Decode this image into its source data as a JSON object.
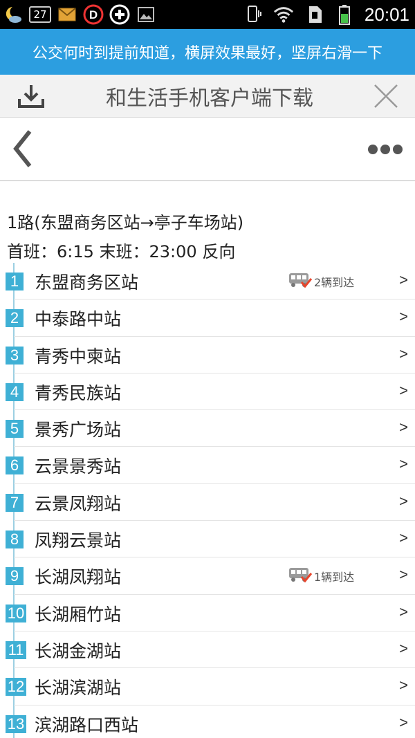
{
  "status_bar": {
    "notification_count": "27",
    "time": "20:01",
    "icons": [
      "weather-moon-icon",
      "calendar-badge-icon",
      "mail-icon",
      "d-app-icon",
      "add-circle-icon",
      "image-icon",
      "vibrate-icon",
      "wifi-icon",
      "sim-icon",
      "battery-icon"
    ]
  },
  "tip_banner": {
    "text": "公交何时到提前知道，横屏效果最好，坚屏右滑一下"
  },
  "download_bar": {
    "text": "和生活手机客户端下载"
  },
  "route": {
    "title": "1路(东盟商务区站→亭子车场站)",
    "times": "首班：6:15 末班：23:00 反向"
  },
  "stations": [
    {
      "num": "1",
      "name": "东盟商务区站",
      "bus": "2辆到达",
      "arrow": ">"
    },
    {
      "num": "2",
      "name": "中泰路中站",
      "bus": "",
      "arrow": ">"
    },
    {
      "num": "3",
      "name": "青秀中柬站",
      "bus": "",
      "arrow": ">"
    },
    {
      "num": "4",
      "name": "青秀民族站",
      "bus": "",
      "arrow": ">"
    },
    {
      "num": "5",
      "name": "景秀广场站",
      "bus": "",
      "arrow": ">"
    },
    {
      "num": "6",
      "name": "云景景秀站",
      "bus": "",
      "arrow": ">"
    },
    {
      "num": "7",
      "name": "云景凤翔站",
      "bus": "",
      "arrow": ">"
    },
    {
      "num": "8",
      "name": "凤翔云景站",
      "bus": "",
      "arrow": ">"
    },
    {
      "num": "9",
      "name": "长湖凤翔站",
      "bus": "1辆到达",
      "arrow": ">"
    },
    {
      "num": "10",
      "name": "长湖厢竹站",
      "bus": "",
      "arrow": ">"
    },
    {
      "num": "11",
      "name": "长湖金湖站",
      "bus": "",
      "arrow": ">"
    },
    {
      "num": "12",
      "name": "长湖滨湖站",
      "bus": "",
      "arrow": ">"
    },
    {
      "num": "13",
      "name": "滨湖路口西站",
      "bus": "",
      "arrow": ">"
    }
  ],
  "colors": {
    "banner": "#2c9ee0",
    "station_marker": "#3fb0d5",
    "timeline": "#9ccfe2"
  }
}
